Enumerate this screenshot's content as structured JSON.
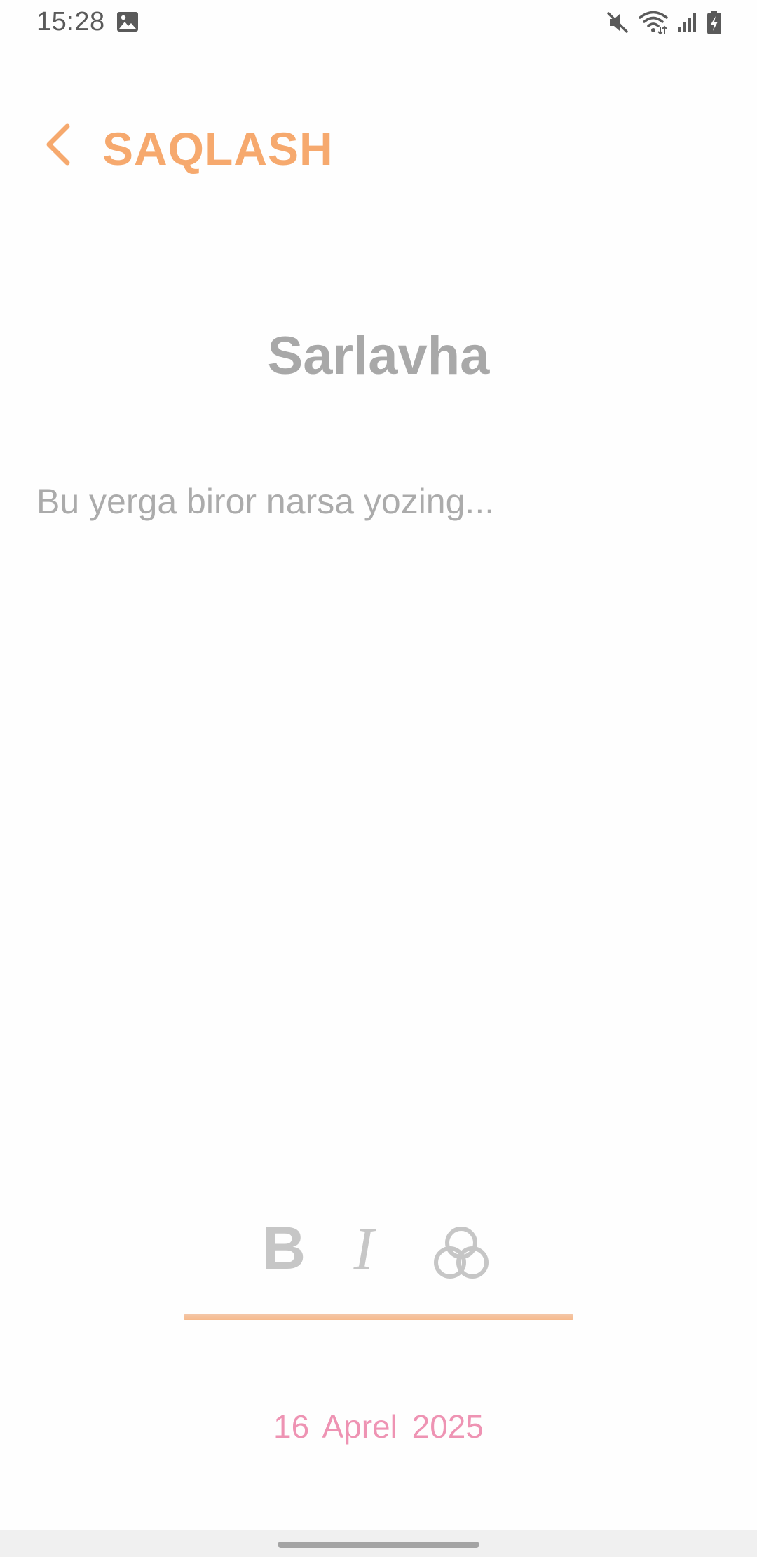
{
  "status_bar": {
    "time": "15:28",
    "icons": [
      "gallery-icon",
      "mute-icon",
      "wifi-icon",
      "signal-icon",
      "battery-charging-icon"
    ]
  },
  "header": {
    "back_icon": "chevron-left-icon",
    "save_label": "SAQLASH"
  },
  "note": {
    "title_placeholder": "Sarlavha",
    "body_placeholder": "Bu yerga biror narsa yozing..."
  },
  "toolbar": {
    "bold_label": "B",
    "italic_label": "I",
    "color_icon": "color-palette-icon"
  },
  "date": {
    "text": "16  Aprel  2025"
  },
  "colors": {
    "accent": "#f6a96e",
    "date": "#ee93b3",
    "placeholder": "#a8a8a8",
    "toolbar_icons": "#c6c6c6"
  }
}
